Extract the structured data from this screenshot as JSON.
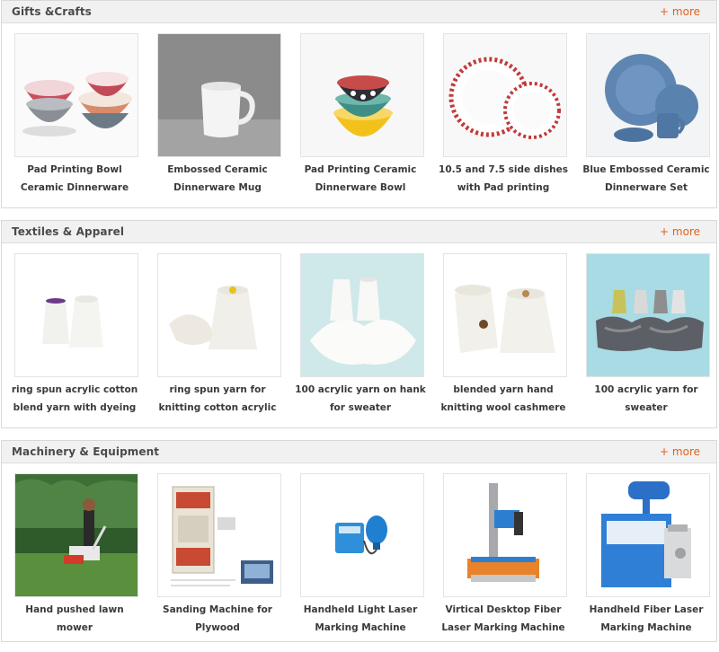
{
  "sections": [
    {
      "title": "Gifts &Crafts",
      "more": "+ more",
      "products": [
        {
          "name": "Pad Printing Bowl Ceramic Dinnerware",
          "image": "stacked-patterned-bowls"
        },
        {
          "name": "Embossed Ceramic Dinnerware Mug",
          "image": "white-mug"
        },
        {
          "name": "Pad Printing Ceramic Dinnerware Bowl",
          "image": "yellow-green-bowl-stack"
        },
        {
          "name": "10.5 and 7.5 side dishes with Pad printing",
          "image": "red-rim-plates"
        },
        {
          "name": "Blue Embossed Ceramic Dinnerware Set",
          "image": "blue-dinnerware-set"
        }
      ]
    },
    {
      "title": "Textiles & Apparel",
      "more": "+ more",
      "products": [
        {
          "name": "ring spun acrylic cotton blend yarn with dyeing",
          "image": "two-yarn-cones"
        },
        {
          "name": "ring spun yarn for knitting cotton acrylic",
          "image": "yarn-cone-with-hank"
        },
        {
          "name": "100 acrylic yarn on hank for sweater",
          "image": "yarn-cones-on-fiber"
        },
        {
          "name": "blended yarn hand knitting wool cashmere",
          "image": "large-yarn-cones"
        },
        {
          "name": "100 acrylic yarn for sweater",
          "image": "grey-yarn-hanks"
        }
      ]
    },
    {
      "title": "Machinery & Equipment",
      "more": "+ more",
      "products": [
        {
          "name": "Hand pushed lawn mower",
          "image": "lawn-mower-photo"
        },
        {
          "name": "Sanding Machine for Plywood",
          "image": "sanding-machine-diagram"
        },
        {
          "name": "Handheld Light Laser Marking Machine",
          "image": "handheld-laser"
        },
        {
          "name": "Virtical Desktop Fiber Laser Marking Machine",
          "image": "desktop-fiber-laser"
        },
        {
          "name": "Handheld Fiber Laser Marking Machine",
          "image": "cabinet-fiber-laser"
        }
      ]
    }
  ]
}
